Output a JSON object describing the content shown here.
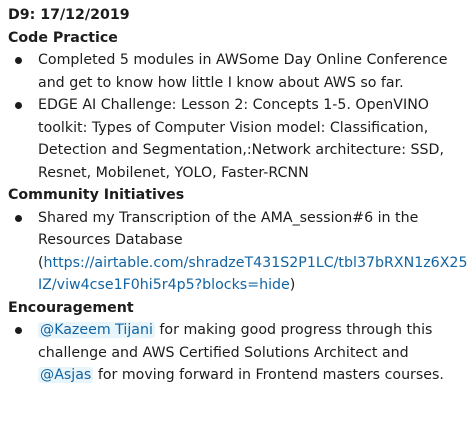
{
  "message": {
    "day_heading": "D9: 17/12/2019",
    "sections": {
      "code_practice": {
        "title": "Code Practice",
        "items": [
          "Completed 5 modules in AWSome Day Online Conference and get to know how little I know about AWS so far.",
          "EDGE AI Challenge: Lesson 2: Concepts 1-5. OpenVINO toolkit: Types of Computer Vision model: Classification, Detection and Segmentation,:Network architecture: SSD, Resnet, Mobilenet, YOLO, Faster-RCNN"
        ]
      },
      "community": {
        "title": "Community Initiatives",
        "item_text": "Shared my Transcription of the AMA_session#6 in the Resources Database",
        "paren_open": "(",
        "link_text": "https://airtable.com/shradzeT431S2P1LC/tbl37bRXN1z6X25IZ/viw4cse1F0hi5r4p5?blocks=hide",
        "paren_close": ")"
      },
      "encouragement": {
        "title": "Encouragement",
        "mention_1": "@Kazeem Tijani",
        "text_1": " for making good progress through this challenge and  AWS Certified Solutions Architect and ",
        "mention_2": "@Asjas",
        "text_2": " for moving forward in Frontend masters courses."
      }
    }
  }
}
